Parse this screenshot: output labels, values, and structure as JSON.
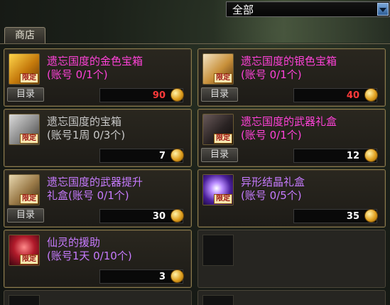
{
  "filter": {
    "value": "全部"
  },
  "tab": {
    "label": "商店"
  },
  "colors": {
    "pink": "#ff42d8",
    "violet": "#c77bff",
    "gray_sub": "#c9c9c9",
    "price_red": "#ff3a3a",
    "price_white": "#ffffff"
  },
  "items": [
    {
      "name": "遗忘国度的金色宝箱",
      "sub": "(账号 0/1个)",
      "catalog": "目录",
      "price": "90",
      "tag": "限定",
      "icon": "gold-chest-icon"
    },
    {
      "name": "遗忘国度的银色宝箱",
      "sub": "(账号 0/1个)",
      "catalog": "目录",
      "price": "40",
      "tag": "限定",
      "icon": "silver-chest-icon"
    },
    {
      "name": "遗忘国度的宝箱",
      "sub": "(账号1周 0/3个)",
      "price": "7",
      "tag": "限定",
      "icon": "chest-icon"
    },
    {
      "name": "遗忘国度的武器礼盒",
      "sub": "(账号 0/1个)",
      "catalog": "目录",
      "price": "12",
      "tag": "限定",
      "icon": "weapon-giftbox-icon"
    },
    {
      "name": "遗忘国度的武器提升",
      "sub": "礼盒(账号 0/1个)",
      "catalog": "目录",
      "price": "30",
      "tag": "限定",
      "icon": "weapon-upgrade-giftbox-icon"
    },
    {
      "name": "异形结晶礼盒",
      "sub": "(账号 0/5个)",
      "price": "35",
      "tag": "限定",
      "icon": "crystal-giftbox-icon"
    },
    {
      "name": "仙灵的援助",
      "sub": "(账号1天 0/10个)",
      "price": "3",
      "tag": "限定",
      "icon": "fairy-aid-icon"
    }
  ]
}
